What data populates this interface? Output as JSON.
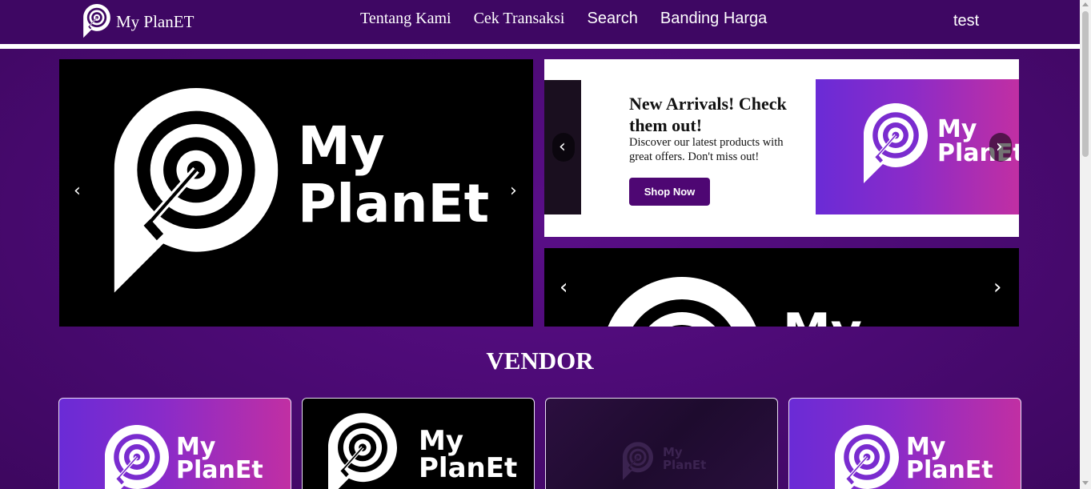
{
  "nav": {
    "brand": "My PlanET",
    "links": [
      "Tentang Kami",
      "Cek Transaksi",
      "Search",
      "Banding Harga"
    ],
    "user": "test"
  },
  "carousel_main": {
    "logo_line1": "My",
    "logo_line2": "PlanEt",
    "prev": "‹",
    "next": "›"
  },
  "carousel_promo": {
    "title": "New Arrivals! Check them out!",
    "description": "Discover our latest products with great offers. Don't miss out!",
    "button": "Shop Now",
    "banner_line1": "My",
    "banner_line2": "PlanEt",
    "prev": "‹",
    "next": "›"
  },
  "carousel_bottom": {
    "logo_line1": "My",
    "prev": "‹",
    "next": "›"
  },
  "vendor": {
    "heading": "VENDOR",
    "cards": [
      {
        "line1": "My",
        "line2": "PlanEt"
      },
      {
        "line1": "My",
        "line2": "PlanEt"
      },
      {
        "line1": "My",
        "line2": "PlanEt"
      },
      {
        "line1": "My",
        "line2": "PlanEt"
      }
    ]
  },
  "colors": {
    "page_bg": "#4a0a72",
    "navbar_bg": "#3e0763",
    "button_bg": "#4e0773",
    "banner_gradient_start": "#6a2bd6",
    "banner_gradient_end": "#c12fa3"
  },
  "icons": {
    "logo": "target-pin-icon",
    "prev": "chevron-left-icon",
    "next": "chevron-right-icon"
  }
}
